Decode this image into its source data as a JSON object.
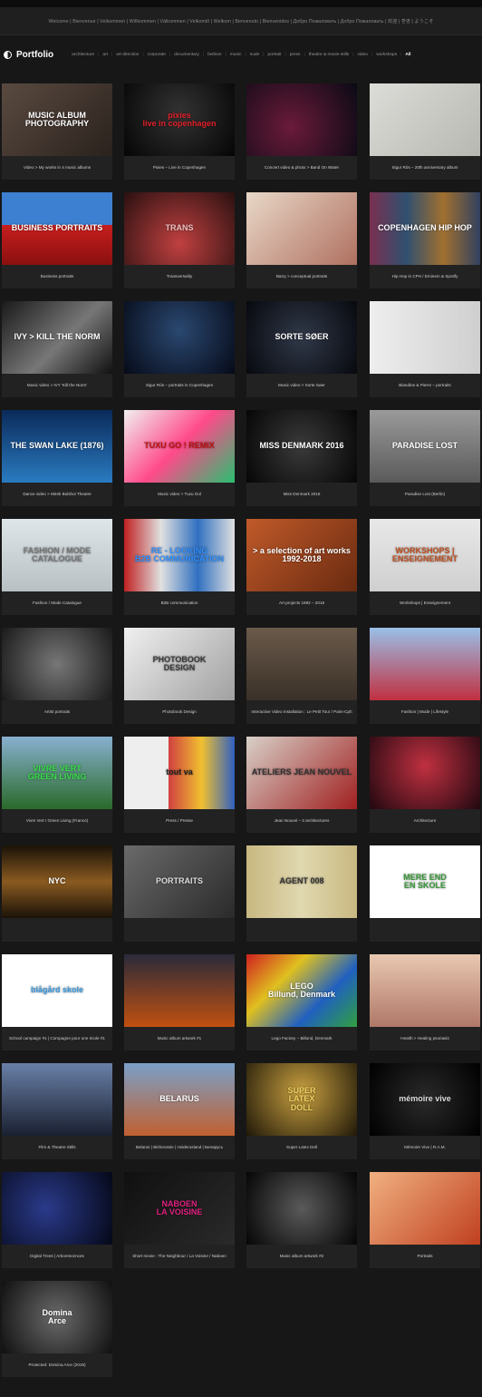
{
  "welcome_text": "Welcome | Bienvenue | Velkommen | Willkommen | Välkommen | Velkomið | Welkom | Benvenuto | Bienvenidos | Добро Пожаловать | Добро Пожаловать | 欢迎 | 환영 | ようこそ",
  "site_title": "Portfolio",
  "menu": [
    "architecture",
    "art",
    "art direction",
    "corporate",
    "documentary",
    "fashion",
    "music",
    "nude",
    "portrait",
    "press",
    "theatre & movie-stills",
    "video",
    "workshops",
    "All"
  ],
  "active_menu": "All",
  "items": [
    {
      "caption": "Video > My works in 4 music albums",
      "overlay": "MUSIC ALBUM\nPHOTOGRAPHY",
      "bg": "linear-gradient(135deg,#5a4a40,#2a221d)",
      "fg": "#ffffff"
    },
    {
      "caption": "Pixies – Live in Copenhagen",
      "overlay": "pixies\nlive in copenhagen",
      "bg": "radial-gradient(circle at 50% 40%,#333,#050505)",
      "fg": "#e0202a"
    },
    {
      "caption": "Concert video & photo > Band On Water",
      "overlay": "",
      "bg": "radial-gradient(circle at 40% 60%,#6a1a3a,#0a0a14)",
      "fg": "#fff"
    },
    {
      "caption": "Sigur Rós – 20th anniversary album",
      "overlay": "",
      "bg": "linear-gradient(135deg,#dcdcd8,#b8b8b2)",
      "fg": "#555"
    },
    {
      "caption": "Business portraits",
      "overlay": "BUSINESS PORTRAITS",
      "bg": "linear-gradient(180deg,#3d7fd0 0%,#3d7fd0 45%,#c81e1e 45%,#8a1010 100%)",
      "fg": "#ffffff"
    },
    {
      "caption": "Transversality",
      "overlay": "TRANS",
      "bg": "radial-gradient(circle at 50% 70%,#c04040,#2a1010)",
      "fg": "#f0c0c0"
    },
    {
      "caption": "Barry > conceptual portraits",
      "overlay": "",
      "bg": "linear-gradient(135deg,#e8d8c8,#b07060)",
      "fg": "#fff"
    },
    {
      "caption": "Hip Hop in CPH / Eminem & Spotify",
      "overlay": "COPENHAGEN HIP HOP",
      "bg": "linear-gradient(90deg,#7a3050,#305070,#a07030,#304060)",
      "fg": "#ffffff"
    },
    {
      "caption": "Music video > IVY 'Kill the Norm'",
      "overlay": "IVY > KILL THE NORM",
      "bg": "linear-gradient(135deg,#1a1a1a,#777 55%,#111)",
      "fg": "#ffffff"
    },
    {
      "caption": "Sigur Rós – portraits in Copenhagen",
      "overlay": "",
      "bg": "radial-gradient(circle at 50% 40%,#2a4870,#060a18)",
      "fg": "#fff"
    },
    {
      "caption": "Music video > Sorte Søer",
      "overlay": "SORTE SØER",
      "bg": "radial-gradient(circle at 50% 50%,#303848,#07090e)",
      "fg": "#ffffff"
    },
    {
      "caption": "Blandine & Pierre – portraits",
      "overlay": "",
      "bg": "linear-gradient(90deg,#eeeeee,#cfcfcf)",
      "fg": "#333"
    },
    {
      "caption": "Dance video > Mirek Bolshoi Theatre",
      "overlay": "THE SWAN LAKE (1876)",
      "bg": "linear-gradient(180deg,#0a2a5a,#2a7ac0)",
      "fg": "#ffffff"
    },
    {
      "caption": "Music video > Tuxu Gol",
      "overlay": "TUXU GO ! REMIX",
      "bg": "linear-gradient(135deg,#f0f0f0,#ff4a8a 50%,#28c070)",
      "fg": "#c01010"
    },
    {
      "caption": "Miss Denmark 2016",
      "overlay": "MISS DENMARK 2016",
      "bg": "radial-gradient(circle at 50% 50%,#3a3a3a,#060606)",
      "fg": "#ffffff"
    },
    {
      "caption": "Paradise Lost (Berlin)",
      "overlay": "PARADISE LOST",
      "bg": "linear-gradient(180deg,#9a9a9a,#5a5a5a)",
      "fg": "#ffffff"
    },
    {
      "caption": "Fashion / Mode Catalogue",
      "overlay": "FASHION / MODE CATALOGUE",
      "bg": "linear-gradient(180deg,#dfe6ea,#b8c0c4)",
      "fg": "#777777"
    },
    {
      "caption": "B2B communication",
      "overlay": "RE - LOOKING\nB2B COMMUNICATION",
      "bg": "linear-gradient(90deg,#c02020,#e0e0e0,#3070c0,#e0e0e0)",
      "fg": "#3090ff"
    },
    {
      "caption": "Art projects 1992 – 2018",
      "overlay": "> a selection of art works\n1992-2018",
      "bg": "linear-gradient(135deg,#c05a2a,#6a2a10)",
      "fg": "#ffffff"
    },
    {
      "caption": "Workshops | Enseignement",
      "overlay": "WORKSHOPS | ENSEIGNEMENT",
      "bg": "linear-gradient(180deg,#e8e8e8,#cfcfcf)",
      "fg": "#c05020"
    },
    {
      "caption": "Artist portraits",
      "overlay": "",
      "bg": "radial-gradient(circle at 50% 50%,#777,#1a1a1a)",
      "fg": "#fff"
    },
    {
      "caption": "Photobook Design",
      "overlay": "PHOTOBOOK\nDESIGN",
      "bg": "linear-gradient(135deg,#f0f0f0,#a0a0a0)",
      "fg": "#3a3a3a"
    },
    {
      "caption": "Interactive Video Installation : Le Petit Tour / Paris-Cph",
      "overlay": "",
      "bg": "linear-gradient(180deg,#6a5a4a,#3a3028)",
      "fg": "#fff"
    },
    {
      "caption": "Fashion | Mode | Lifestyle",
      "overlay": "",
      "bg": "linear-gradient(180deg,#9ac0e8,#c03040)",
      "fg": "#fff"
    },
    {
      "caption": "Vivre Vert I Green Living (France)",
      "overlay": "VIVRE VERT\nGREEN LIVING",
      "bg": "linear-gradient(180deg,#88b0d0,#2a6a2a)",
      "fg": "#39e04a"
    },
    {
      "caption": "Press / Presse",
      "overlay": "tout va",
      "bg": "linear-gradient(90deg,#eeeeee 40%,#d04040 40%,#f0c030 70%,#3060c0)",
      "fg": "#222222"
    },
    {
      "caption": "Jean Nouvel – 3 architectures",
      "overlay": "ATELIERS JEAN NOUVEL",
      "bg": "linear-gradient(135deg,#d8d0c8,#a02020)",
      "fg": "#333333"
    },
    {
      "caption": "Architecture",
      "overlay": "",
      "bg": "radial-gradient(circle at 50% 40%,#c03040,#200810)",
      "fg": "#fff"
    },
    {
      "caption": "",
      "overlay": "NYC",
      "bg": "linear-gradient(180deg,#1a1208,#8a5a20 50%,#1a1208)",
      "fg": "#ffffff"
    },
    {
      "caption": "",
      "overlay": "PORTRAITS",
      "bg": "linear-gradient(135deg,#6a6a6a,#2a2a2a)",
      "fg": "#dddddd"
    },
    {
      "caption": "",
      "overlay": "AGENT 008",
      "bg": "linear-gradient(90deg,#c8b880,#e0d8b0,#c8b880)",
      "fg": "#333333"
    },
    {
      "caption": "",
      "overlay": "MERE END\nEN SKOLE",
      "bg": "#ffffff",
      "fg": "#3a9a3a"
    },
    {
      "caption": "School campaign #1 | Compagne pour une école #1",
      "overlay": "blågård skole",
      "bg": "#ffffff",
      "fg": "#3a9ae0"
    },
    {
      "caption": "Music album artwork #1",
      "overlay": "",
      "bg": "linear-gradient(180deg,#2a2a3a,#c05010)",
      "fg": "#fff"
    },
    {
      "caption": "Lego Factory – Billund, Denmark",
      "overlay": "LEGO\nBillund, Denmark",
      "bg": "linear-gradient(135deg,#d02020,#e0c020,#2060c0,#30a040)",
      "fg": "#ffffff"
    },
    {
      "caption": "Health > Healing psoriasis",
      "overlay": "",
      "bg": "linear-gradient(180deg,#e8c8b0,#b07868)",
      "fg": "#fff"
    },
    {
      "caption": "Film & Theatre Stills",
      "overlay": "",
      "bg": "linear-gradient(180deg,#6a80a8,#1a2030)",
      "fg": "#fff"
    },
    {
      "caption": "Belarus | Biélorussie | Hviderusland | Беларусь",
      "overlay": "BELARUS",
      "bg": "linear-gradient(180deg,#7aa0c8,#c06030)",
      "fg": "#ffffff"
    },
    {
      "caption": "Super Latex Doll",
      "overlay": "SUPER\nLATEX\nDOLL",
      "bg": "radial-gradient(circle at 50% 40%,#c8a040,#201808)",
      "fg": "#f0d060"
    },
    {
      "caption": "Mémoire Vive | R.A.M.",
      "overlay": "mémoire vive",
      "bg": "radial-gradient(circle at 50% 50%,#2a2a2a,#000)",
      "fg": "#dddddd"
    },
    {
      "caption": "Digital Trees | Arborescences",
      "overlay": "",
      "bg": "radial-gradient(circle at 40% 50%,#2a3a8a,#050818)",
      "fg": "#fff"
    },
    {
      "caption": "Short movie : The Neighbour / La Voisine / Naboen",
      "overlay": "NABOEN\nLA VOISINE",
      "bg": "linear-gradient(135deg,#101010,#2a2a2a)",
      "fg": "#e02080"
    },
    {
      "caption": "Music album artwork #2",
      "overlay": "",
      "bg": "radial-gradient(circle at 50% 50%,#5a5a5a,#050505)",
      "fg": "#fff"
    },
    {
      "caption": "Portraits",
      "overlay": "",
      "bg": "linear-gradient(135deg,#f0b080,#c04020)",
      "fg": "#fff"
    },
    {
      "caption": "Protected: Domina Arce (2019)",
      "overlay": "Domina\nArce",
      "bg": "radial-gradient(circle at 50% 50%,#6a6a6a,#101010)",
      "fg": "#ffffff"
    }
  ]
}
